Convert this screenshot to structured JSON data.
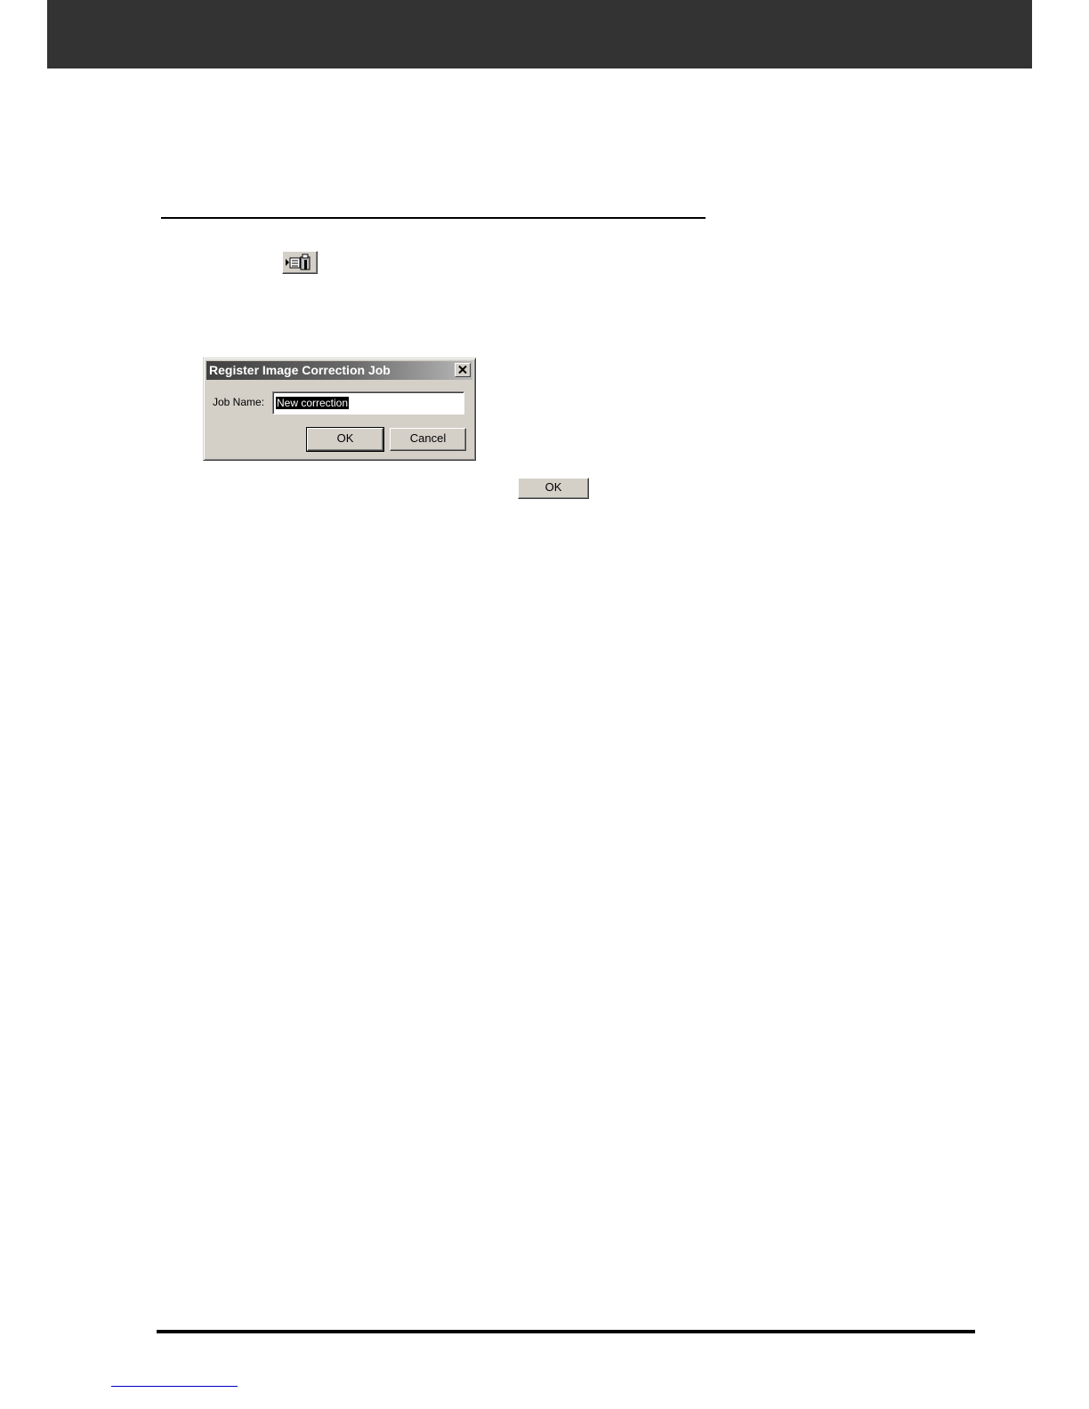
{
  "dialog": {
    "title": "Register Image Correction Job",
    "job_name_label": "Job Name:",
    "job_name_value": "New correction",
    "ok_label": "OK",
    "cancel_label": "Cancel"
  },
  "inline_button": {
    "label": "OK"
  },
  "icons": {
    "toolbar": "register-job-icon",
    "close": "close-icon"
  },
  "colors": {
    "header_bar": "#333333",
    "dialog_face": "#d4d0c8"
  }
}
